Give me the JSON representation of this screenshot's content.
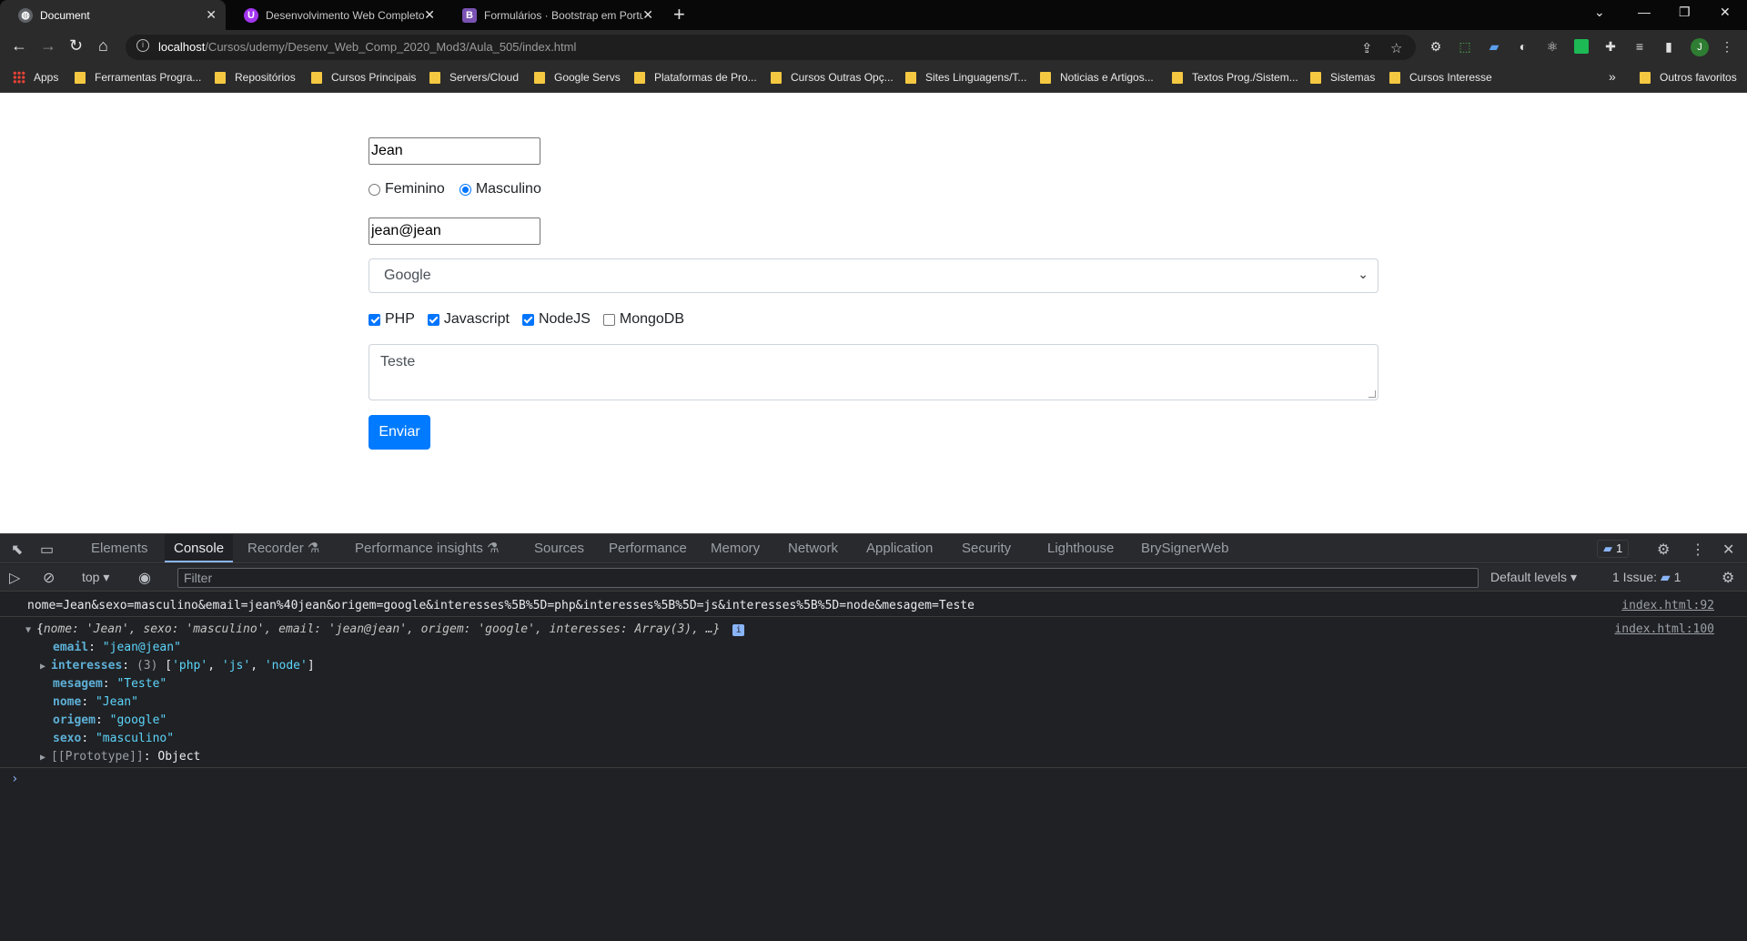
{
  "tabs": [
    {
      "title": "Document",
      "active": true,
      "favicon_color": "#5f6368"
    },
    {
      "title": "Desenvolvimento Web Completo",
      "active": false,
      "favicon_color": "#a435f0"
    },
    {
      "title": "Formulários · Bootstrap em Portu",
      "active": false,
      "favicon_color": "#7952b3"
    }
  ],
  "address_bar": {
    "host": "localhost",
    "path": "/Cursos/udemy/Desenv_Web_Comp_2020_Mod3/Aula_505/index.html"
  },
  "bookmarks": [
    "Apps",
    "Ferramentas Progra...",
    "Repositórios",
    "Cursos Principais",
    "Servers/Cloud",
    "Google Servs",
    "Plataformas de Pro...",
    "Cursos Outras Opç...",
    "Sites Linguagens/T...",
    "Noticias e Artigos...",
    "Textos Prog./Sistem...",
    "Sistemas",
    "Cursos Interesse"
  ],
  "bookmarks_more": "»",
  "other_bookmarks": "Outros favoritos",
  "avatar_letter": "J",
  "form": {
    "nome_value": "Jean",
    "radio_feminino": "Feminino",
    "radio_masculino": "Masculino",
    "email_value": "jean@jean",
    "origem_selected": "Google",
    "interesses": [
      {
        "label": "PHP",
        "checked": true
      },
      {
        "label": "Javascript",
        "checked": true
      },
      {
        "label": "NodeJS",
        "checked": true
      },
      {
        "label": "MongoDB",
        "checked": false
      }
    ],
    "mensagem_value": "Teste",
    "submit_label": "Enviar"
  },
  "devtools": {
    "tabs": [
      "Elements",
      "Console",
      "Recorder",
      "Performance insights",
      "Sources",
      "Performance",
      "Memory",
      "Network",
      "Application",
      "Security",
      "Lighthouse",
      "BrySignerWeb"
    ],
    "active_tab": "Console",
    "message_count": "1",
    "context": "top",
    "filter_placeholder": "Filter",
    "levels": "Default levels",
    "issues_label": "1 Issue:",
    "issues_count": "1",
    "console_lines": {
      "query_string": "nome=Jean&sexo=masculino&email=jean%40jean&origem=google&interesses%5B%5D=php&interesses%5B%5D=js&interesses%5B%5D=node&mesagem=Teste",
      "query_link": "index.html:92",
      "object_link": "index.html:100",
      "object_summary_prefix": "{",
      "object_fields": [
        {
          "key": "email",
          "value": "\"jean@jean\""
        },
        {
          "key": "mesagem",
          "value": "\"Teste\""
        },
        {
          "key": "nome",
          "value": "\"Jean\""
        },
        {
          "key": "origem",
          "value": "\"google\""
        },
        {
          "key": "sexo",
          "value": "\"masculino\""
        }
      ],
      "interesses_key": "interesses",
      "interesses_count": "(3)",
      "interesses_items": [
        "'php'",
        "'js'",
        "'node'"
      ],
      "prototype_label": "[[Prototype]]",
      "prototype_value": "Object"
    }
  }
}
